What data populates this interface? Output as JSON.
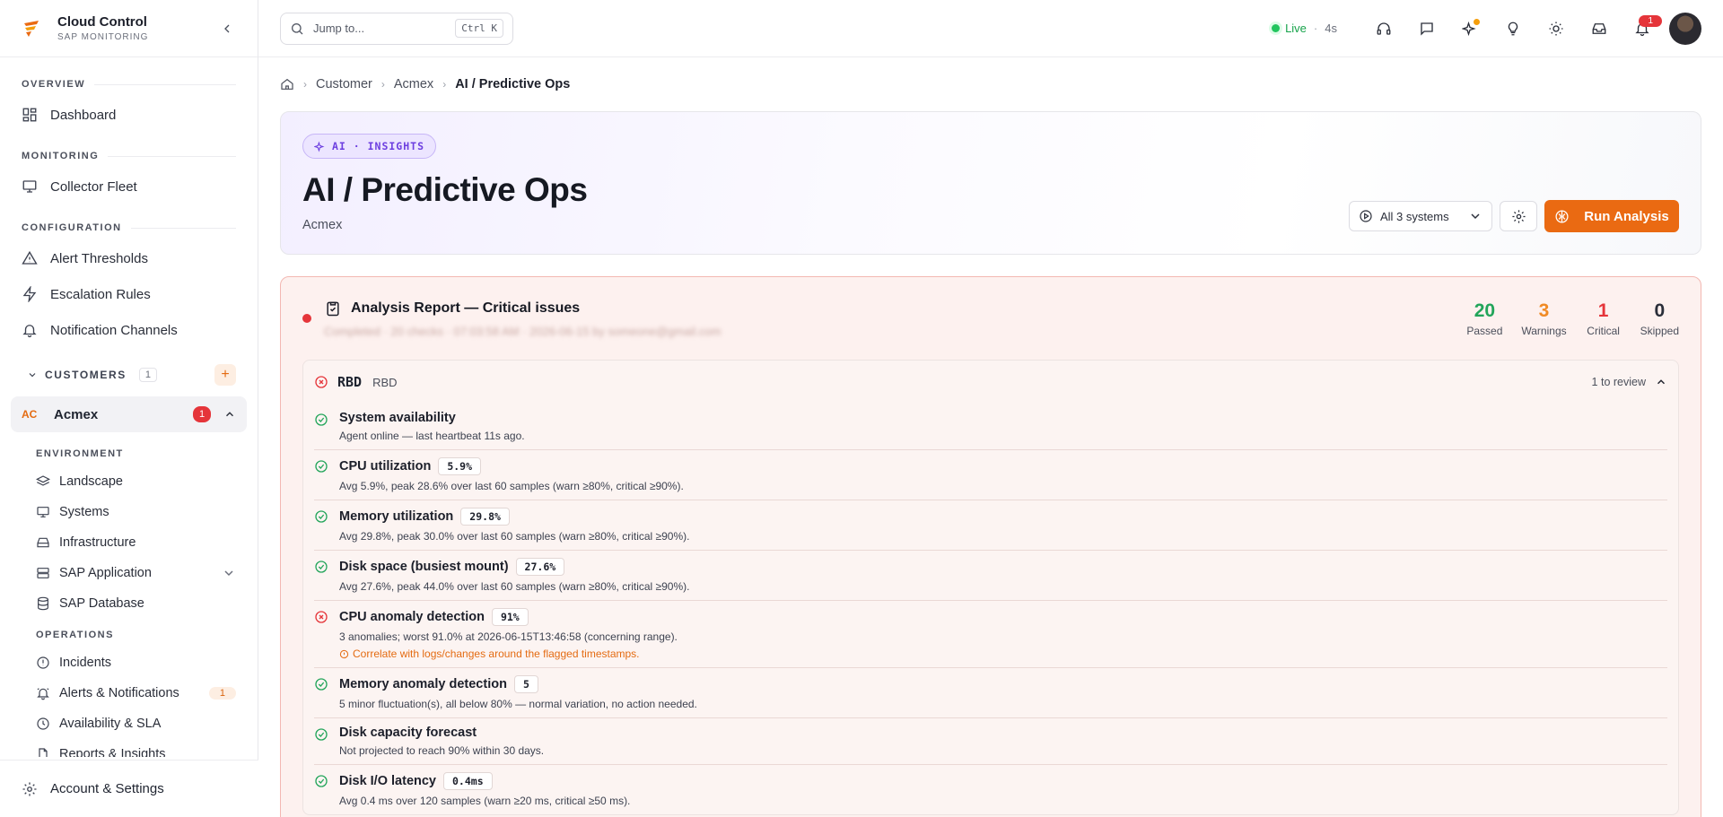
{
  "brand": {
    "name": "Cloud Control",
    "subtitle": "SAP MONITORING"
  },
  "sidebar": {
    "sections": [
      {
        "title": "OVERVIEW",
        "items": [
          {
            "label": "Dashboard",
            "icon": "dashboard-icon"
          }
        ]
      },
      {
        "title": "MONITORING",
        "items": [
          {
            "label": "Collector Fleet",
            "icon": "monitor-icon"
          }
        ]
      },
      {
        "title": "CONFIGURATION",
        "items": [
          {
            "label": "Alert Thresholds",
            "icon": "warning-icon"
          },
          {
            "label": "Escalation Rules",
            "icon": "bolt-icon"
          },
          {
            "label": "Notification Channels",
            "icon": "bell-icon"
          }
        ]
      }
    ],
    "customers": {
      "label": "CUSTOMERS",
      "count": "1"
    },
    "customer": {
      "initials": "AC",
      "name": "Acmex",
      "badge": "1"
    },
    "environment": {
      "title": "ENVIRONMENT",
      "items": [
        {
          "label": "Landscape"
        },
        {
          "label": "Systems"
        },
        {
          "label": "Infrastructure"
        },
        {
          "label": "SAP Application"
        },
        {
          "label": "SAP Database"
        }
      ]
    },
    "operations": {
      "title": "OPERATIONS",
      "items": [
        {
          "label": "Incidents"
        },
        {
          "label": "Alerts & Notifications",
          "badge": "1"
        },
        {
          "label": "Availability & SLA"
        },
        {
          "label": "Reports & Insights"
        }
      ]
    },
    "account": "Account & Settings"
  },
  "topbar": {
    "search_placeholder": "Jump to...",
    "shortcut": "Ctrl K",
    "live_label": "Live",
    "live_age": "4s",
    "notification_count": "1"
  },
  "breadcrumb": {
    "items": [
      "Customer",
      "Acmex"
    ],
    "current": "AI / Predictive Ops"
  },
  "hero": {
    "pill": "AI · INSIGHTS",
    "title": "AI / Predictive Ops",
    "subtitle": "Acmex",
    "system_select": "All 3 systems",
    "run_label": "Run Analysis"
  },
  "report": {
    "title": "Analysis Report — Critical issues",
    "meta": "Completed · 20 checks · 07:03:58 AM · 2026-06-15 by someone@gmail.com",
    "stats": [
      {
        "value": "20",
        "label": "Passed",
        "color": "#22a55a"
      },
      {
        "value": "3",
        "label": "Warnings",
        "color": "#f08a24"
      },
      {
        "value": "1",
        "label": "Critical",
        "color": "#e5353a"
      },
      {
        "value": "0",
        "label": "Skipped",
        "color": "#2a2e39"
      }
    ],
    "group": {
      "code": "RBD",
      "desc": "RBD",
      "review": "1 to review"
    },
    "checks": [
      {
        "title": "System availability",
        "value": "",
        "status": "pass",
        "desc": "Agent online — last heartbeat 11s ago."
      },
      {
        "title": "CPU utilization",
        "value": "5.9%",
        "status": "pass",
        "desc": "Avg 5.9%, peak 28.6% over last 60 samples (warn ≥80%, critical ≥90%)."
      },
      {
        "title": "Memory utilization",
        "value": "29.8%",
        "status": "pass",
        "desc": "Avg 29.8%, peak 30.0% over last 60 samples (warn ≥80%, critical ≥90%)."
      },
      {
        "title": "Disk space (busiest mount)",
        "value": "27.6%",
        "status": "pass",
        "desc": "Avg 27.6%, peak 44.0% over last 60 samples (warn ≥80%, critical ≥90%)."
      },
      {
        "title": "CPU anomaly detection",
        "value": "91%",
        "status": "fail",
        "desc": "3 anomalies; worst 91.0% at 2026-06-15T13:46:58 (concerning range).",
        "hint": "Correlate with logs/changes around the flagged timestamps."
      },
      {
        "title": "Memory anomaly detection",
        "value": "5",
        "status": "pass",
        "desc": "5 minor fluctuation(s), all below 80% — normal variation, no action needed."
      },
      {
        "title": "Disk capacity forecast",
        "value": "",
        "status": "pass",
        "desc": "Not projected to reach 90% within 30 days."
      },
      {
        "title": "Disk I/O latency",
        "value": "0.4ms",
        "status": "pass",
        "desc": "Avg 0.4 ms over 120 samples (warn ≥20 ms, critical ≥50 ms)."
      }
    ]
  }
}
